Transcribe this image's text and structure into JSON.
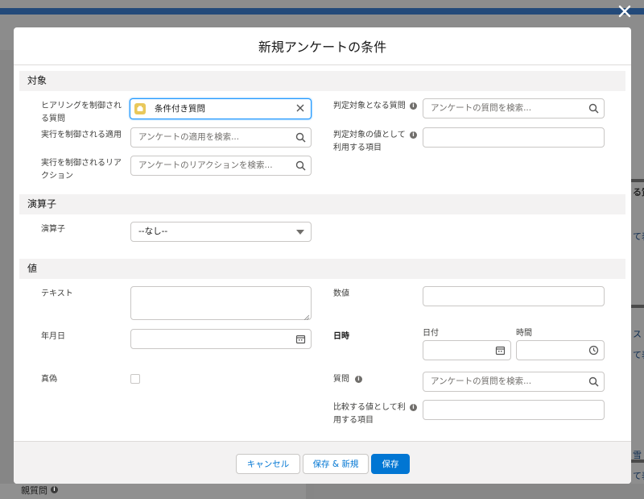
{
  "background": {
    "texts": [
      "る質",
      "て表",
      "ス",
      "て表",
      "雪",
      "て表"
    ],
    "bottom_label": "親質問"
  },
  "modal": {
    "title": "新規アンケートの条件",
    "sections": {
      "target": "対象",
      "operator": "演算子",
      "value": "値"
    },
    "target": {
      "hearing_label": "ヒアリングを制御される質問",
      "hearing_selected": "条件付き質問",
      "apply_label": "実行を制御される適用",
      "apply_placeholder": "アンケートの適用を検索...",
      "reaction_label": "実行を制御されるリアクション",
      "reaction_placeholder": "アンケートのリアクションを検索...",
      "judge_question_label": "判定対象となる質問",
      "judge_question_placeholder": "アンケートの質問を検索...",
      "judge_value_label": "判定対象の値として利用する項目",
      "judge_value_value": ""
    },
    "operator": {
      "label": "演算子",
      "selected": "--なし--"
    },
    "value": {
      "text_label": "テキスト",
      "number_label": "数値",
      "date_label": "年月日",
      "datetime_label": "日時",
      "date_sub_label": "日付",
      "time_sub_label": "時間",
      "bool_label": "真偽",
      "question_label": "質問",
      "question_placeholder": "アンケートの質問を検索...",
      "compare_label": "比較する値として利用する項目"
    },
    "footer": {
      "cancel": "キャンセル",
      "save_new": "保存 & 新規",
      "save": "保存"
    }
  },
  "colors": {
    "brand": "#0176d3",
    "focus": "#1b96ff",
    "section_bg": "#f3f2f2",
    "header_band": "#234a7a"
  }
}
